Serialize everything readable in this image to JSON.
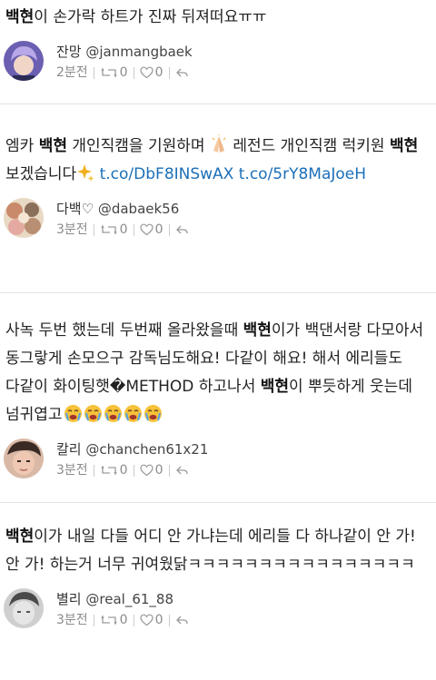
{
  "tweets": [
    {
      "text_parts": [
        {
          "t": "백현",
          "hl": true
        },
        {
          "t": "이 손가락 하트가 진짜 뒤져떠요ㅠㅠ"
        }
      ],
      "display_name": "잔망",
      "handle": "@janmangbaek",
      "time": "2분전",
      "retweets": "0",
      "likes": "0",
      "avatar_icon": "avatar-purple-hair-person"
    },
    {
      "text_parts": [
        {
          "t": "엠카 "
        },
        {
          "t": "백현",
          "hl": true
        },
        {
          "t": " 개인직캠을 기원하며 "
        },
        {
          "emoji": "pray"
        },
        {
          "t": " 레전드 개인직캠 럭키원 "
        },
        {
          "t": "백현",
          "hl": true
        },
        {
          "t": " 보겠습니다"
        },
        {
          "emoji": "sparkle"
        },
        {
          "t": " "
        },
        {
          "t": "t.co/DbF8INSwAX",
          "link": true
        },
        {
          "t": " "
        },
        {
          "t": "t.co/5rY8MaJoeH",
          "link": true
        }
      ],
      "display_name": "다백♡",
      "handle": "@dabaek56",
      "time": "3분전",
      "retweets": "0",
      "likes": "0",
      "avatar_icon": "avatar-collage"
    },
    {
      "text_parts": [
        {
          "t": "사녹 두번 했는데 두번째 올라왔을때 "
        },
        {
          "t": "백현",
          "hl": true
        },
        {
          "t": "이가 백댄서랑 다모아서 동그랗게 손모으구 감독님도해요! 다같이 해요! 해서 에리들도 다같이 화이팅햇�METHOD"
        },
        {
          "t": " 하고나서 "
        },
        {
          "t": "백현",
          "hl": true
        },
        {
          "t": "이 뿌듯하게 웃는데 넘귀엽고"
        },
        {
          "emoji": "face"
        },
        {
          "emoji": "face"
        },
        {
          "emoji": "face"
        },
        {
          "emoji": "face"
        },
        {
          "emoji": "face"
        }
      ],
      "display_name": "칼리",
      "handle": "@chanchen61x21",
      "time": "3분전",
      "retweets": "0",
      "likes": "0",
      "avatar_icon": "avatar-person-face"
    },
    {
      "text_parts": [
        {
          "t": "백현",
          "hl": true
        },
        {
          "t": "이가 내일 다들 어디 안 가냐는데 에리들 다 하나같이 안 가! 안 가! 하는거 너무 귀여웠닭ㅋㅋㅋㅋㅋㅋㅋㅋㅋㅋㅋㅋㅋㅋㅋㅋ"
        }
      ],
      "display_name": "별리",
      "handle": "@real_61_88",
      "time": "3분전",
      "retweets": "0",
      "likes": "0",
      "avatar_icon": "avatar-gray-person"
    }
  ],
  "colors": {
    "link": "#1b6fb8",
    "meta": "#8b8b8b",
    "divider": "#e3e3e3"
  }
}
